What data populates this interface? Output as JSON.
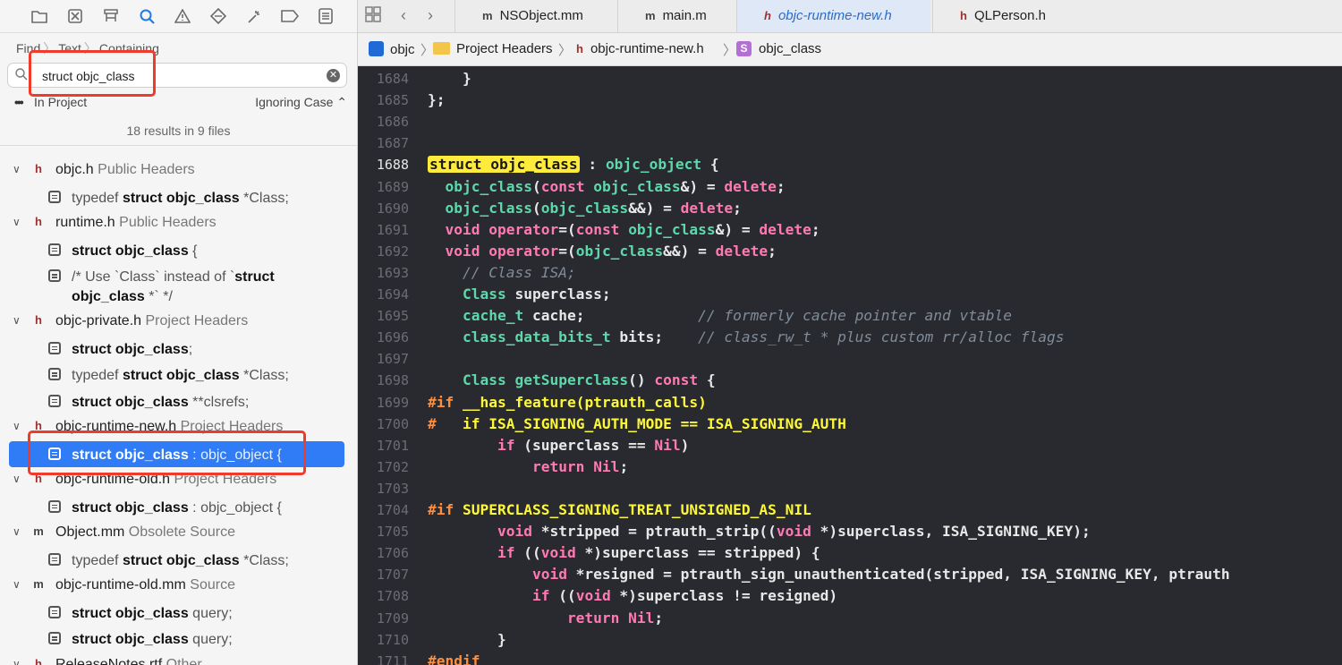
{
  "navigator": {
    "toolbar_icons": [
      "folder-icon",
      "x-square-icon",
      "hierarchy-icon",
      "search-icon",
      "warning-icon",
      "diamond-icon",
      "wand-icon",
      "tag-icon",
      "list-icon"
    ],
    "find_breadcrumb": [
      "Find",
      "Text",
      "Containing"
    ],
    "search_value": "struct objc_class",
    "scope_label": "In Project",
    "case_label": "Ignoring Case",
    "results_count": "18 results in 9 files",
    "results": [
      {
        "kind": "file",
        "icon": "h",
        "name": "objc.h",
        "group": "Public Headers"
      },
      {
        "kind": "match",
        "pre": "typedef ",
        "bold": "struct objc_class",
        "post": " *Class;"
      },
      {
        "kind": "file",
        "icon": "h",
        "name": "runtime.h",
        "group": "Public Headers"
      },
      {
        "kind": "match",
        "pre": "",
        "bold": "struct objc_class",
        "post": " {"
      },
      {
        "kind": "match",
        "tall": true,
        "pre": "/* Use `Class` instead of `",
        "bold": "struct objc_class",
        "post": " *` */"
      },
      {
        "kind": "file",
        "icon": "h",
        "name": "objc-private.h",
        "group": "Project Headers"
      },
      {
        "kind": "match",
        "pre": "",
        "bold": "struct objc_class",
        "post": ";"
      },
      {
        "kind": "match",
        "pre": "typedef ",
        "bold": "struct objc_class",
        "post": " *Class;"
      },
      {
        "kind": "match",
        "pre": "",
        "bold": "struct objc_class",
        "post": " **clsrefs;"
      },
      {
        "kind": "file",
        "icon": "h",
        "name": "objc-runtime-new.h",
        "group": "Project Headers"
      },
      {
        "kind": "match",
        "selected": true,
        "pre": "",
        "bold": "struct objc_class",
        "post": " : objc_object {"
      },
      {
        "kind": "file",
        "icon": "h",
        "name": "objc-runtime-old.h",
        "group": "Project Headers"
      },
      {
        "kind": "match",
        "pre": "",
        "bold": "struct objc_class",
        "post": " : objc_object {"
      },
      {
        "kind": "file",
        "icon": "m",
        "name": "Object.mm",
        "group": "Obsolete Source"
      },
      {
        "kind": "match",
        "pre": "typedef ",
        "bold": "struct objc_class",
        "post": " *Class;"
      },
      {
        "kind": "file",
        "icon": "m",
        "name": "objc-runtime-old.mm",
        "group": "Source"
      },
      {
        "kind": "match",
        "pre": "",
        "bold": "struct objc_class",
        "post": " query;"
      },
      {
        "kind": "match",
        "pre": "",
        "bold": "struct objc_class",
        "post": " query;"
      },
      {
        "kind": "file",
        "icon": "h",
        "name": "ReleaseNotes.rtf",
        "group": "Other"
      }
    ]
  },
  "tabs": [
    {
      "icon": "m",
      "label": "NSObject.mm",
      "active": false
    },
    {
      "icon": "m",
      "label": "main.m",
      "active": false
    },
    {
      "icon": "h",
      "label": "objc-runtime-new.h",
      "active": true
    },
    {
      "icon": "h",
      "label": "QLPerson.h",
      "active": false
    }
  ],
  "jump_bar": [
    "objc",
    "Project Headers",
    "objc-runtime-new.h",
    "objc_class"
  ],
  "editor": {
    "current_line": 1688,
    "lines": [
      {
        "n": 1684,
        "html": "    }"
      },
      {
        "n": 1685,
        "html": "};"
      },
      {
        "n": 1686,
        "html": ""
      },
      {
        "n": 1687,
        "html": ""
      },
      {
        "n": 1688,
        "html": "<span class=\"hl\">struct objc_class</span> : <span class=\"ty\">objc_object</span> {"
      },
      {
        "n": 1689,
        "html": "  <span class=\"ty\">objc_class</span>(<span class=\"kw\">const</span> <span class=\"ty\">objc_class</span>&amp;) = <span class=\"kw\">delete</span>;"
      },
      {
        "n": 1690,
        "html": "  <span class=\"ty\">objc_class</span>(<span class=\"ty\">objc_class</span>&amp;&amp;) = <span class=\"kw\">delete</span>;"
      },
      {
        "n": 1691,
        "html": "  <span class=\"kw\">void</span> <span class=\"kw\">operator</span>=(<span class=\"kw\">const</span> <span class=\"ty\">objc_class</span>&amp;) = <span class=\"kw\">delete</span>;"
      },
      {
        "n": 1692,
        "html": "  <span class=\"kw\">void</span> <span class=\"kw\">operator</span>=(<span class=\"ty\">objc_class</span>&amp;&amp;) = <span class=\"kw\">delete</span>;"
      },
      {
        "n": 1693,
        "html": "    <span class=\"cm\">// Class ISA;</span>"
      },
      {
        "n": 1694,
        "html": "    <span class=\"ty\">Class</span> superclass;"
      },
      {
        "n": 1695,
        "html": "    <span class=\"ty\">cache_t</span> cache;             <span class=\"cm\">// formerly cache pointer and vtable</span>"
      },
      {
        "n": 1696,
        "html": "    <span class=\"ty\">class_data_bits_t</span> bits;    <span class=\"cm\">// class_rw_t * plus custom rr/alloc flags</span>"
      },
      {
        "n": 1697,
        "html": ""
      },
      {
        "n": 1698,
        "html": "    <span class=\"ty\">Class</span> <span class=\"ty\">getSuperclass</span>() <span class=\"kw\">const</span> {"
      },
      {
        "n": 1699,
        "html": "<span class=\"pp\">#if</span> <span class=\"mac\">__has_feature(ptrauth_calls)</span>"
      },
      {
        "n": 1700,
        "html": "<span class=\"pp\">#</span>   <span class=\"mac\">if ISA_SIGNING_AUTH_MODE == ISA_SIGNING_AUTH</span>"
      },
      {
        "n": 1701,
        "html": "        <span class=\"kw\">if</span> (superclass == <span class=\"nil\">Nil</span>)"
      },
      {
        "n": 1702,
        "html": "            <span class=\"kw\">return</span> <span class=\"nil\">Nil</span>;"
      },
      {
        "n": 1703,
        "html": ""
      },
      {
        "n": 1704,
        "html": "<span class=\"pp\">#if</span> <span class=\"mac\">SUPERCLASS_SIGNING_TREAT_UNSIGNED_AS_NIL</span>"
      },
      {
        "n": 1705,
        "html": "        <span class=\"kw\">void</span> *stripped = ptrauth_strip((<span class=\"kw\">void</span> *)superclass, ISA_SIGNING_KEY);"
      },
      {
        "n": 1706,
        "html": "        <span class=\"kw\">if</span> ((<span class=\"kw\">void</span> *)superclass == stripped) {"
      },
      {
        "n": 1707,
        "html": "            <span class=\"kw\">void</span> *resigned = ptrauth_sign_unauthenticated(stripped, ISA_SIGNING_KEY, ptrauth"
      },
      {
        "n": 1708,
        "html": "            <span class=\"kw\">if</span> ((<span class=\"kw\">void</span> *)superclass != resigned)"
      },
      {
        "n": 1709,
        "html": "                <span class=\"kw\">return</span> <span class=\"nil\">Nil</span>;"
      },
      {
        "n": 1710,
        "html": "        }"
      },
      {
        "n": 1711,
        "html": "<span class=\"pp\">#endif</span>"
      }
    ]
  }
}
